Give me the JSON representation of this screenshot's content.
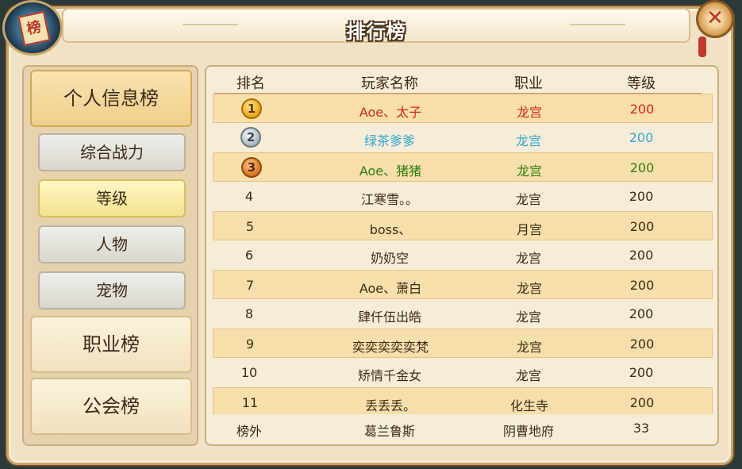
{
  "window": {
    "title": "排行榜",
    "logo_text": "榜",
    "close_glyph": "✕"
  },
  "sidebar": {
    "categories": [
      {
        "label": "个人信息榜"
      },
      {
        "label": "职业榜"
      },
      {
        "label": "公会榜"
      }
    ],
    "subcategories": [
      {
        "label": "综合战力"
      },
      {
        "label": "等级"
      },
      {
        "label": "人物"
      },
      {
        "label": "宠物"
      }
    ]
  },
  "table": {
    "headers": [
      "排名",
      "玩家名称",
      "职业",
      "等级"
    ],
    "rows": [
      {
        "rank": "1",
        "name": "Aoe、太子",
        "job": "龙宫",
        "level": "200"
      },
      {
        "rank": "2",
        "name": "绿茶爹爹",
        "job": "龙宫",
        "level": "200"
      },
      {
        "rank": "3",
        "name": "Aoe、猪猪",
        "job": "龙宫",
        "level": "200"
      },
      {
        "rank": "4",
        "name": "江寒雪。。",
        "job": "龙宫",
        "level": "200"
      },
      {
        "rank": "5",
        "name": "boss、",
        "job": "月宫",
        "level": "200"
      },
      {
        "rank": "6",
        "name": "奶奶空",
        "job": "龙宫",
        "level": "200"
      },
      {
        "rank": "7",
        "name": "Aoe、萧白",
        "job": "龙宫",
        "level": "200"
      },
      {
        "rank": "8",
        "name": "肆仟伍出皓",
        "job": "龙宫",
        "level": "200"
      },
      {
        "rank": "9",
        "name": "奕奕奕奕奕梵",
        "job": "龙宫",
        "level": "200"
      },
      {
        "rank": "10",
        "name": "矫情千金女",
        "job": "龙宫",
        "level": "200"
      },
      {
        "rank": "11",
        "name": "丢丢丢。",
        "job": "化生寺",
        "level": "200"
      }
    ],
    "self_row": {
      "rank": "榜外",
      "name": "葛兰鲁斯",
      "job": "阴曹地府",
      "level": "33"
    }
  },
  "colors": {
    "rank1": "#d8261c",
    "rank2": "#2ea7d6",
    "rank3": "#2e7d12"
  }
}
